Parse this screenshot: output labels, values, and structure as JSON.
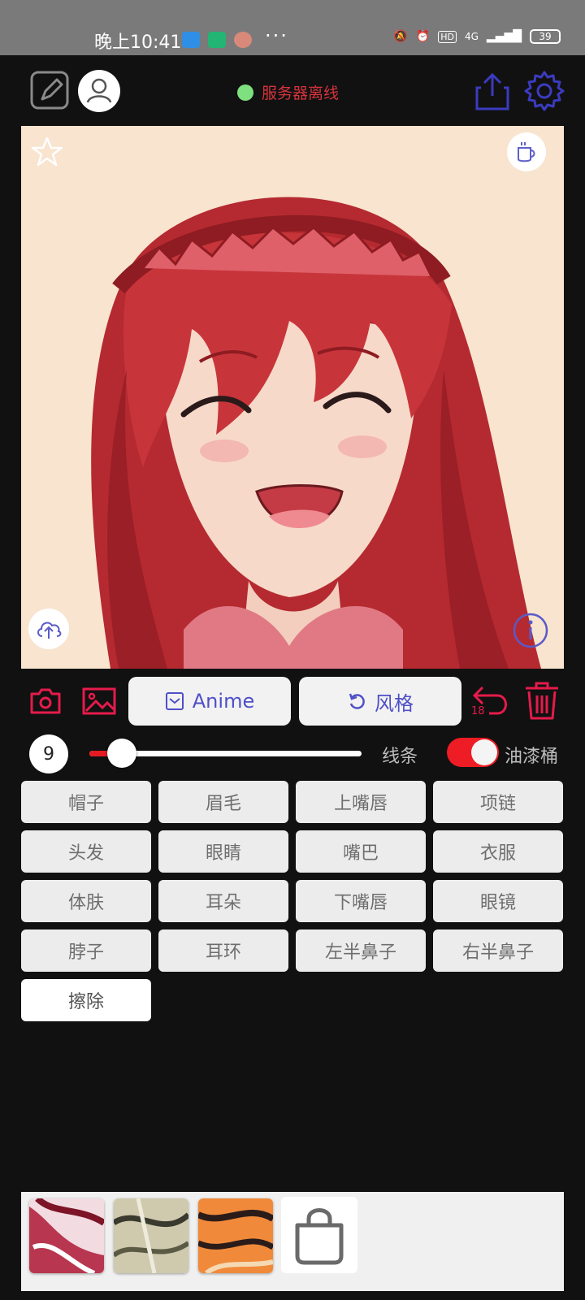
{
  "status_bar": {
    "time": "晚上10:41",
    "more": "···",
    "network": "4G",
    "battery": "39"
  },
  "header": {
    "server_status": "服务器离线",
    "server_status_color": "#d6333c"
  },
  "tools": {
    "model_button": "Anime",
    "style_button": "风格",
    "undo_count": "18"
  },
  "brush": {
    "size": "9",
    "size_fraction": 0.12,
    "line_label": "线条",
    "bucket_label": "油漆桶",
    "bucket_enabled": true
  },
  "parts": [
    "帽子",
    "眉毛",
    "上嘴唇",
    "项链",
    "头发",
    "眼睛",
    "嘴巴",
    "衣服",
    "体肤",
    "耳朵",
    "下嘴唇",
    "眼镜",
    "脖子",
    "耳环",
    "左半鼻子",
    "右半鼻子",
    "擦除"
  ],
  "colors": {
    "accent_red": "#e51b23",
    "accent_blue": "#4f4fc8"
  }
}
